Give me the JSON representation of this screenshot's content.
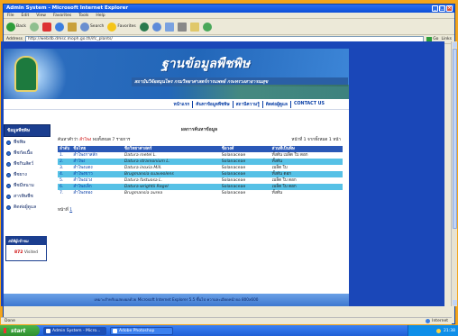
{
  "window": {
    "title": "Admin System - Microsoft Internet Explorer",
    "controls": {
      "minimize": "_",
      "maximize": "□",
      "close": "×"
    }
  },
  "menu": [
    "File",
    "Edit",
    "View",
    "Favorites",
    "Tools",
    "Help"
  ],
  "toolbar": {
    "back": "Back",
    "search": "Search",
    "favorites": "Favorites"
  },
  "address": {
    "label": "Address",
    "url": "http://webdb.dmsc.moph.go.th/ifc_plants/",
    "go": "Go",
    "links": "Links"
  },
  "site": {
    "title": "ฐานข้อมูลพืชพิษ",
    "subtitle": "สถาบันวิจัยสมุนไพร กรมวิทยาศาสตร์การแพทย์ กระทรวงสาธารณสุข"
  },
  "nav": [
    "หน้าแรก",
    "ค้นหาข้อมูลพืชพิษ",
    "สถานีความรู้",
    "ติดต่อผู้ดูแล",
    "CONTACT US"
  ],
  "sidebar": {
    "heading": "ข้อมูลพืชพิษ",
    "items": [
      "พืชพิษ",
      "พืชกัดเนื้อ",
      "พืชกินสัตว์",
      "พืชยาง",
      "พืชมีหนาม",
      "สารพิษพืช",
      "ติดต่อผู้ดูแล"
    ]
  },
  "counter": {
    "heading": "สถิติผู้เข้าชม",
    "count": "872",
    "label": "Visited"
  },
  "content": {
    "title": "ผลการค้นหาข้อมูล",
    "result_text": "ค้นหาคำว่า",
    "result_count": "พบทั้งหมด 7 รายการ",
    "keyword": "ลำโพง",
    "page_info": "หน้าที่ 1 จากทั้งหมด 1 หน้า",
    "columns": [
      "ลำดับ",
      "ชื่อไทย",
      "ชื่อวิทยาศาสตร์",
      "ชื่อวงศ์",
      "ส่วนที่เป็นพิษ"
    ],
    "rows": [
      {
        "no": "1.",
        "thai": "ลำโพงกาสลัก",
        "sci": "Datura metel L.",
        "family": "Solanaceae",
        "part": "ทั้งต้น เมล็ด ใบ ดอก"
      },
      {
        "no": "2.",
        "thai": "ลำโพง",
        "sci": "Datura stramonium L.",
        "family": "Solanaceae",
        "part": "ทั้งต้น"
      },
      {
        "no": "3.",
        "thai": "ลำโพงแดง",
        "sci": "Datura inoxia Mill.",
        "family": "Solanaceae",
        "part": "เมล็ด ใบ"
      },
      {
        "no": "4.",
        "thai": "ลำโพงขาว",
        "sci": "Brugmansia suaveolens",
        "family": "Solanaceae",
        "part": "ทั้งต้น ดอก"
      },
      {
        "no": "5.",
        "thai": "ลำโพงม่วง",
        "sci": "Datura fastuosa L.",
        "family": "Solanaceae",
        "part": "เมล็ด ใบ ดอก"
      },
      {
        "no": "6.",
        "thai": "ลำโพงเล็ก",
        "sci": "Datura wrightii Regel",
        "family": "Solanaceae",
        "part": "เมล็ด ใบ ดอก"
      },
      {
        "no": "7.",
        "thai": "ลำโพงทอง",
        "sci": "Brugmansia aurea",
        "family": "Solanaceae",
        "part": "ทั้งต้น"
      }
    ],
    "pager_label": "หน้าที่",
    "pager_page": "1"
  },
  "footer": "เหมาะสำหรับแสดงผลด้วย Microsoft Internet Explorer 5.5 ขึ้นไป ความละเอียดหน้าจอ 800x600",
  "status": {
    "left": "Done",
    "zone": "Internet"
  },
  "taskbar": {
    "start": "start",
    "tasks": [
      "Admin System - Micro...",
      "Adobe Photoshop"
    ],
    "clock": "21:38"
  }
}
